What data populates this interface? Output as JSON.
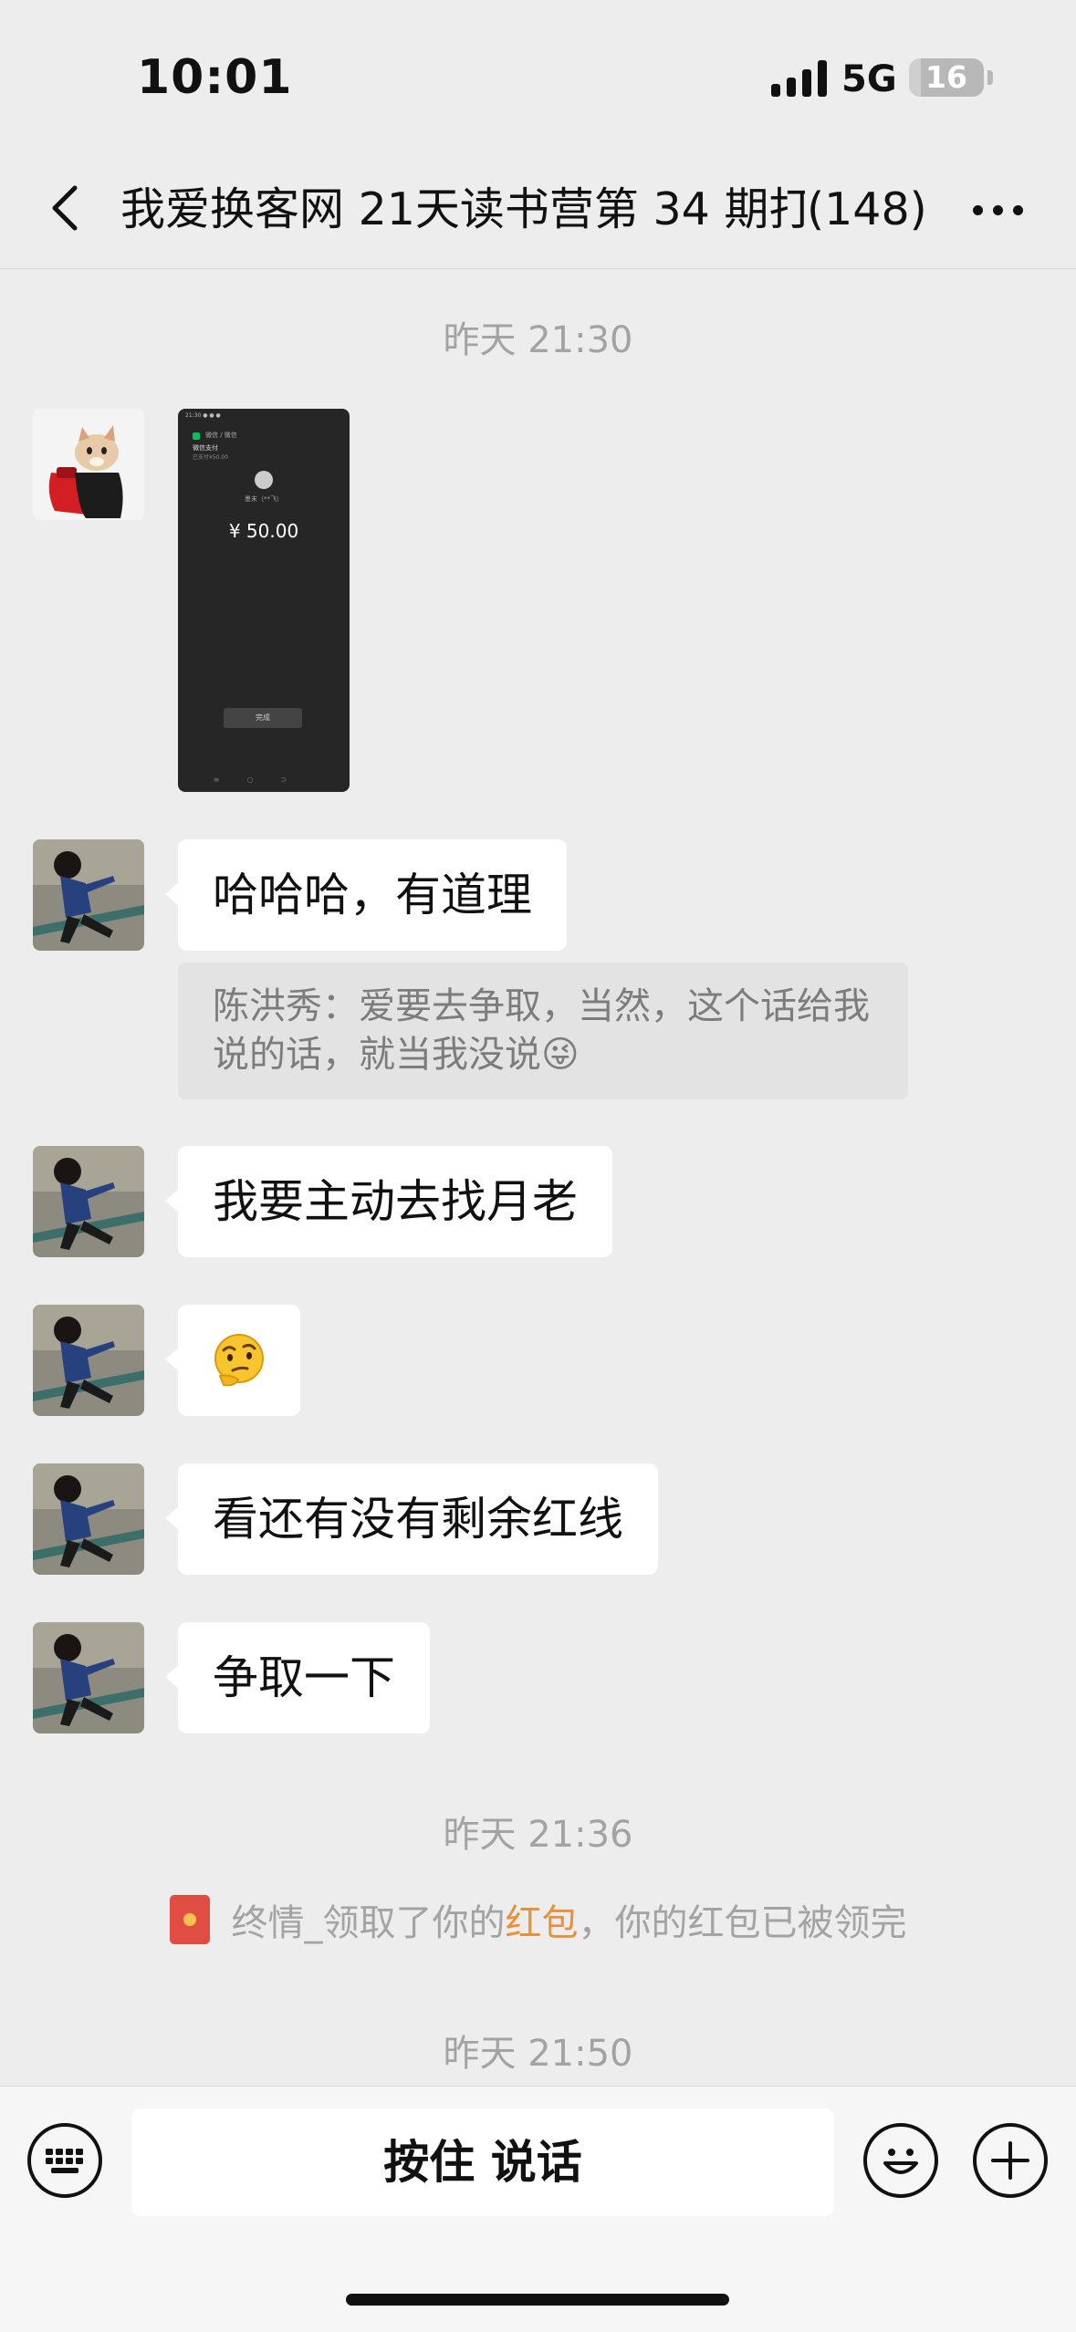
{
  "status": {
    "time": "10:01",
    "network": "5G",
    "battery": "16",
    "battery_level": 0.16
  },
  "nav": {
    "back_icon": "chevron-left-icon",
    "title": "我爱换客网 21天读书营第 34 期打卡",
    "count": "(148)",
    "more_icon": "ellipsis-icon"
  },
  "messages": [
    {
      "type": "time",
      "text": "昨天 21:30"
    },
    {
      "type": "image",
      "sender": "cat-avatar",
      "payment": {
        "app": "微信 / 微信",
        "title": "微信支付",
        "subtitle": "已支付¥50.00",
        "payee": "墨末（**飞）",
        "amount": "¥ 50.00",
        "done": "完成"
      }
    },
    {
      "type": "text",
      "sender": "kid-avatar",
      "text": "哈哈哈，有道理"
    },
    {
      "type": "quote",
      "text": "陈洪秀：爱要去争取，当然，这个话给我说的话，就当我没说😜"
    },
    {
      "type": "text",
      "sender": "kid-avatar",
      "text": "我要主动去找月老"
    },
    {
      "type": "text",
      "sender": "kid-avatar",
      "text": "🤔"
    },
    {
      "type": "text",
      "sender": "kid-avatar",
      "text": "看还有没有剩余红线"
    },
    {
      "type": "text",
      "sender": "kid-avatar",
      "text": "争取一下"
    },
    {
      "type": "time",
      "text": "昨天 21:36"
    },
    {
      "type": "system",
      "prefix": "终情_领取了你的",
      "link": "红包",
      "suffix": "，你的红包已被领完"
    },
    {
      "type": "time",
      "text": "昨天 21:50"
    }
  ],
  "toolbar": {
    "keyboard_icon": "keyboard-icon",
    "hold_to_talk": "按住 说话",
    "emoji_icon": "smiley-icon",
    "plus_icon": "plus-icon"
  },
  "colors": {
    "background": "#ededed",
    "bubble": "#ffffff",
    "link": "#e8903a",
    "red_packet": "#e24d43"
  }
}
